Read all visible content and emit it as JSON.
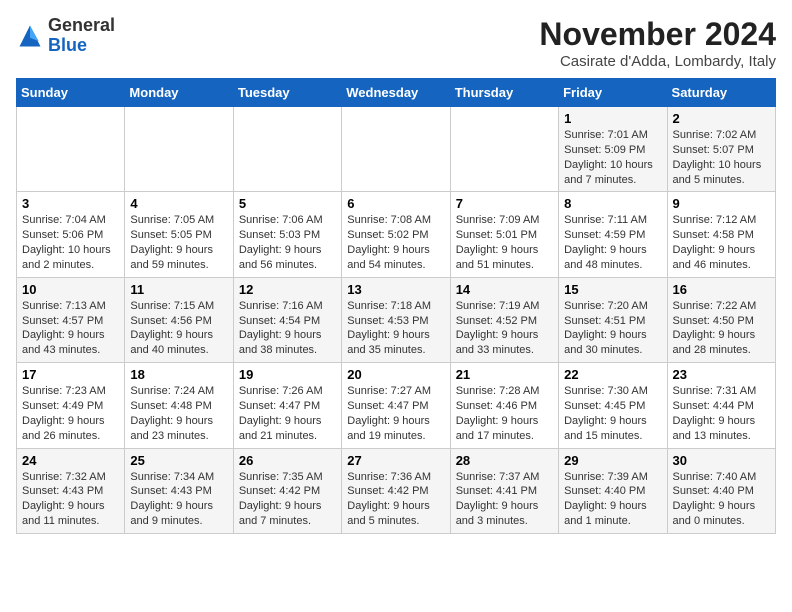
{
  "header": {
    "logo": {
      "general": "General",
      "blue": "Blue"
    },
    "title": "November 2024",
    "location": "Casirate d'Adda, Lombardy, Italy"
  },
  "weekdays": [
    "Sunday",
    "Monday",
    "Tuesday",
    "Wednesday",
    "Thursday",
    "Friday",
    "Saturday"
  ],
  "weeks": [
    [
      {
        "day": "",
        "info": ""
      },
      {
        "day": "",
        "info": ""
      },
      {
        "day": "",
        "info": ""
      },
      {
        "day": "",
        "info": ""
      },
      {
        "day": "",
        "info": ""
      },
      {
        "day": "1",
        "info": "Sunrise: 7:01 AM\nSunset: 5:09 PM\nDaylight: 10 hours and 7 minutes."
      },
      {
        "day": "2",
        "info": "Sunrise: 7:02 AM\nSunset: 5:07 PM\nDaylight: 10 hours and 5 minutes."
      }
    ],
    [
      {
        "day": "3",
        "info": "Sunrise: 7:04 AM\nSunset: 5:06 PM\nDaylight: 10 hours and 2 minutes."
      },
      {
        "day": "4",
        "info": "Sunrise: 7:05 AM\nSunset: 5:05 PM\nDaylight: 9 hours and 59 minutes."
      },
      {
        "day": "5",
        "info": "Sunrise: 7:06 AM\nSunset: 5:03 PM\nDaylight: 9 hours and 56 minutes."
      },
      {
        "day": "6",
        "info": "Sunrise: 7:08 AM\nSunset: 5:02 PM\nDaylight: 9 hours and 54 minutes."
      },
      {
        "day": "7",
        "info": "Sunrise: 7:09 AM\nSunset: 5:01 PM\nDaylight: 9 hours and 51 minutes."
      },
      {
        "day": "8",
        "info": "Sunrise: 7:11 AM\nSunset: 4:59 PM\nDaylight: 9 hours and 48 minutes."
      },
      {
        "day": "9",
        "info": "Sunrise: 7:12 AM\nSunset: 4:58 PM\nDaylight: 9 hours and 46 minutes."
      }
    ],
    [
      {
        "day": "10",
        "info": "Sunrise: 7:13 AM\nSunset: 4:57 PM\nDaylight: 9 hours and 43 minutes."
      },
      {
        "day": "11",
        "info": "Sunrise: 7:15 AM\nSunset: 4:56 PM\nDaylight: 9 hours and 40 minutes."
      },
      {
        "day": "12",
        "info": "Sunrise: 7:16 AM\nSunset: 4:54 PM\nDaylight: 9 hours and 38 minutes."
      },
      {
        "day": "13",
        "info": "Sunrise: 7:18 AM\nSunset: 4:53 PM\nDaylight: 9 hours and 35 minutes."
      },
      {
        "day": "14",
        "info": "Sunrise: 7:19 AM\nSunset: 4:52 PM\nDaylight: 9 hours and 33 minutes."
      },
      {
        "day": "15",
        "info": "Sunrise: 7:20 AM\nSunset: 4:51 PM\nDaylight: 9 hours and 30 minutes."
      },
      {
        "day": "16",
        "info": "Sunrise: 7:22 AM\nSunset: 4:50 PM\nDaylight: 9 hours and 28 minutes."
      }
    ],
    [
      {
        "day": "17",
        "info": "Sunrise: 7:23 AM\nSunset: 4:49 PM\nDaylight: 9 hours and 26 minutes."
      },
      {
        "day": "18",
        "info": "Sunrise: 7:24 AM\nSunset: 4:48 PM\nDaylight: 9 hours and 23 minutes."
      },
      {
        "day": "19",
        "info": "Sunrise: 7:26 AM\nSunset: 4:47 PM\nDaylight: 9 hours and 21 minutes."
      },
      {
        "day": "20",
        "info": "Sunrise: 7:27 AM\nSunset: 4:47 PM\nDaylight: 9 hours and 19 minutes."
      },
      {
        "day": "21",
        "info": "Sunrise: 7:28 AM\nSunset: 4:46 PM\nDaylight: 9 hours and 17 minutes."
      },
      {
        "day": "22",
        "info": "Sunrise: 7:30 AM\nSunset: 4:45 PM\nDaylight: 9 hours and 15 minutes."
      },
      {
        "day": "23",
        "info": "Sunrise: 7:31 AM\nSunset: 4:44 PM\nDaylight: 9 hours and 13 minutes."
      }
    ],
    [
      {
        "day": "24",
        "info": "Sunrise: 7:32 AM\nSunset: 4:43 PM\nDaylight: 9 hours and 11 minutes."
      },
      {
        "day": "25",
        "info": "Sunrise: 7:34 AM\nSunset: 4:43 PM\nDaylight: 9 hours and 9 minutes."
      },
      {
        "day": "26",
        "info": "Sunrise: 7:35 AM\nSunset: 4:42 PM\nDaylight: 9 hours and 7 minutes."
      },
      {
        "day": "27",
        "info": "Sunrise: 7:36 AM\nSunset: 4:42 PM\nDaylight: 9 hours and 5 minutes."
      },
      {
        "day": "28",
        "info": "Sunrise: 7:37 AM\nSunset: 4:41 PM\nDaylight: 9 hours and 3 minutes."
      },
      {
        "day": "29",
        "info": "Sunrise: 7:39 AM\nSunset: 4:40 PM\nDaylight: 9 hours and 1 minute."
      },
      {
        "day": "30",
        "info": "Sunrise: 7:40 AM\nSunset: 4:40 PM\nDaylight: 9 hours and 0 minutes."
      }
    ]
  ]
}
